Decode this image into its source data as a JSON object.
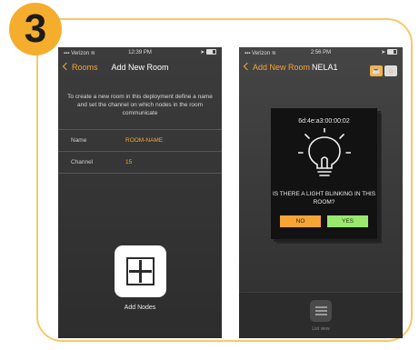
{
  "step": {
    "number": "3"
  },
  "phone1": {
    "status": {
      "carrier": "Verizon",
      "time": "12:39 PM"
    },
    "nav": {
      "back_label": "Rooms",
      "title": "Add New Room"
    },
    "description": "To create a new room in this deployment define a name and set the channel on which nodes in the room communicate",
    "fields": [
      {
        "label": "Name",
        "value": "ROOM-NAME"
      },
      {
        "label": "Channel",
        "value": "15"
      }
    ],
    "add_nodes_label": "Add Nodes"
  },
  "phone2": {
    "status": {
      "carrier": "Verizon",
      "time": "2:56 PM"
    },
    "nav": {
      "back_label": "Add New Room",
      "title": "NELA1"
    },
    "modal": {
      "mac": "6d:4e:a3:00:00:02",
      "question": "IS THERE A LIGHT BLINKING IN THIS ROOM?",
      "no_label": "NO",
      "yes_label": "YES"
    },
    "tab": {
      "label": "List view"
    }
  },
  "colors": {
    "accent": "#f4a534",
    "yes": "#9be86e",
    "badge": "#f5ad2d",
    "frame": "#f6c96a"
  },
  "icons": [
    "wifi-icon",
    "signal-icon",
    "battery-icon",
    "location-icon",
    "lightbulb-icon",
    "plus-square-icon",
    "list-icon"
  ]
}
